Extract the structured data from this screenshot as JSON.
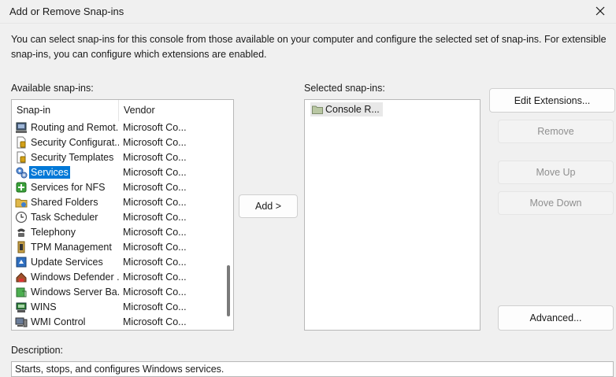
{
  "dialog": {
    "title": "Add or Remove Snap-ins",
    "intro": "You can select snap-ins for this console from those available on your computer and configure the selected set of snap-ins. For extensible snap-ins, you can configure which extensions are enabled."
  },
  "available": {
    "label": "Available snap-ins:",
    "headers": {
      "snapin": "Snap-in",
      "vendor": "Vendor"
    },
    "rows": [
      {
        "name": "Routing and Remot...",
        "vendor": "Microsoft Co...",
        "icon": "server-monitor-icon"
      },
      {
        "name": "Security Configurat...",
        "vendor": "Microsoft Co...",
        "icon": "security-doc-icon"
      },
      {
        "name": "Security Templates",
        "vendor": "Microsoft Co...",
        "icon": "security-doc-icon"
      },
      {
        "name": "Services",
        "vendor": "Microsoft Co...",
        "icon": "gears-icon",
        "selected": true
      },
      {
        "name": "Services for NFS",
        "vendor": "Microsoft Co...",
        "icon": "nfs-icon"
      },
      {
        "name": "Shared Folders",
        "vendor": "Microsoft Co...",
        "icon": "shared-folder-icon"
      },
      {
        "name": "Task Scheduler",
        "vendor": "Microsoft Co...",
        "icon": "clock-icon"
      },
      {
        "name": "Telephony",
        "vendor": "Microsoft Co...",
        "icon": "telephone-icon"
      },
      {
        "name": "TPM Management",
        "vendor": "Microsoft Co...",
        "icon": "tpm-chip-icon"
      },
      {
        "name": "Update Services",
        "vendor": "Microsoft Co...",
        "icon": "update-icon"
      },
      {
        "name": "Windows Defender ...",
        "vendor": "Microsoft Co...",
        "icon": "firewall-icon"
      },
      {
        "name": "Windows Server Ba...",
        "vendor": "Microsoft Co...",
        "icon": "backup-icon"
      },
      {
        "name": "WINS",
        "vendor": "Microsoft Co...",
        "icon": "wins-server-icon"
      },
      {
        "name": "WMI Control",
        "vendor": "Microsoft Co...",
        "icon": "wmi-computer-icon"
      }
    ]
  },
  "selected": {
    "label": "Selected snap-ins:",
    "items": [
      {
        "name": "Console R...",
        "icon": "folder-icon"
      }
    ]
  },
  "buttons": {
    "add": "Add >",
    "edit_extensions": "Edit Extensions...",
    "remove": "Remove",
    "move_up": "Move Up",
    "move_down": "Move Down",
    "advanced": "Advanced..."
  },
  "description": {
    "label": "Description:",
    "text": "Starts, stops, and configures Windows services."
  },
  "colors": {
    "selection": "#0078d7",
    "background": "#f0f0f0"
  }
}
